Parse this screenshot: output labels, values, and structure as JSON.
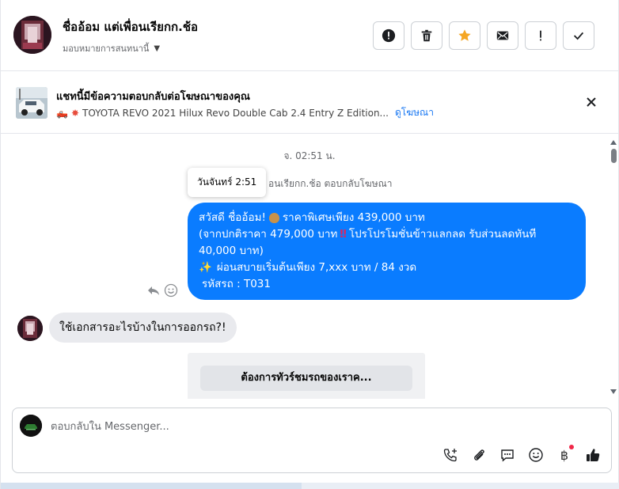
{
  "header": {
    "contact_name": "ชื่ออ้อม แต่เพื่อนเรียกก.ช้อ",
    "assign_label": "มอบหมายการสนทนานี้",
    "actions": [
      {
        "name": "spam-button",
        "icon": "alert-circle-icon"
      },
      {
        "name": "delete-button",
        "icon": "trash-icon"
      },
      {
        "name": "star-button",
        "icon": "star-icon"
      },
      {
        "name": "mark-unread-button",
        "icon": "envelope-icon"
      },
      {
        "name": "follow-up-button",
        "icon": "exclamation-icon"
      },
      {
        "name": "done-button",
        "icon": "check-icon"
      }
    ],
    "accent_star": "#f5a623"
  },
  "ad_banner": {
    "title": "แชทนี้มีข้อความตอบกลับต่อโฆษณาของคุณ",
    "ad_text": "TOYOTA REVO 2021 Hilux Revo Double Cab 2.4 Entry Z Edition...",
    "link": "ดูโฆษณา"
  },
  "chat": {
    "time_label": "จ. 02:51 น.",
    "tooltip": "วันจันทร์ 2:51",
    "reply_note": "อนเรียกก.ช้อ ตอบกลับโฆษณา",
    "outgoing": {
      "line1_a": "สวัสดี ชื่ออ้อม!",
      "line1_b": "ราคาพิเศษเพียง 439,000 บาท",
      "line2_a": "(จากปกติราคา 479,000 บาท",
      "line2_b": "โปรโปรโมชั่นข้าวแลกลด รับส่วนลดทันที 40,000 บาท)",
      "line3": "ผ่อนสบายเริ่มต้นเพียง 7,xxx บาท / 84 งวด",
      "line4": "รหัสรถ : T031"
    },
    "incoming_text": "ใช้เอกสารอะไรบ้างในการออกรถ?!",
    "card_button": "ต้องการทัวร์ชมรถของเราค...",
    "bubble_color": "#0a7cff"
  },
  "composer": {
    "placeholder": "ตอบกลับใน Messenger...",
    "currency_glyph": "฿",
    "tools": [
      "phone-add-icon",
      "paperclip-icon",
      "saved-reply-icon",
      "emoji-icon",
      "baht-icon",
      "thumbs-up-icon"
    ]
  }
}
